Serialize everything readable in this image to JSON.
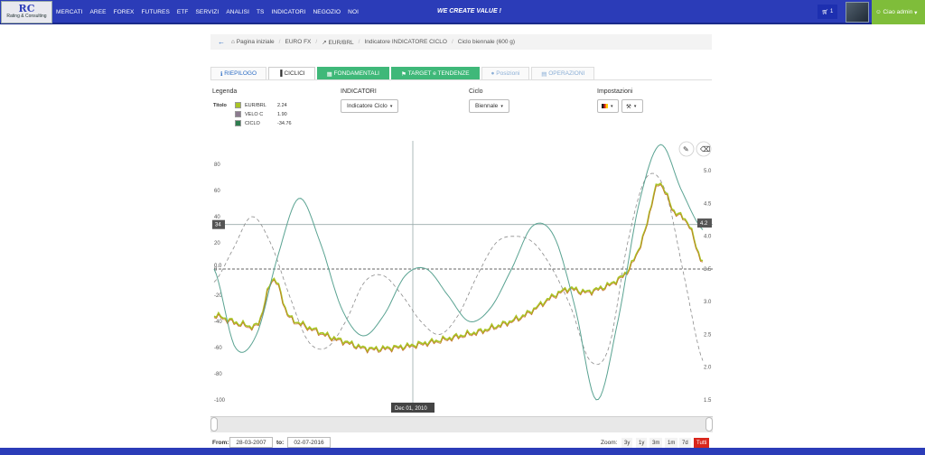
{
  "header": {
    "logo_mark": "RC",
    "logo_text": "Rating & Consulting",
    "nav": [
      "MERCATI",
      "AREE",
      "FOREX",
      "FUTURES",
      "ETF",
      "SERVIZI",
      "ANALISI",
      "TS",
      "INDICATORI",
      "NEGOZIO",
      "NOI"
    ],
    "slogan": "WE CREATE VALUE !",
    "cart_count": "1",
    "user_label": "Ciao admin"
  },
  "breadcrumb": [
    "Pagina iniziale",
    "EURO FX",
    "EUR/BRL",
    "Indicatore INDICATORE CICLO",
    "Ciclo biennale (600 g)"
  ],
  "tabs": [
    {
      "label": "RIEPILOGO",
      "icon": "info-icon"
    },
    {
      "label": "CICLICI",
      "icon": "bar-chart-icon"
    },
    {
      "label": "FONDAMENTALI",
      "icon": "table-icon"
    },
    {
      "label": "TARGET e TENDENZE",
      "icon": "pin-icon"
    },
    {
      "label": "Posizioni",
      "icon": "circle-icon"
    },
    {
      "label": "OPERAZIONI",
      "icon": "calculator-icon"
    }
  ],
  "controls": {
    "legend_label": "Legenda",
    "legend_title": "Titolo",
    "legend": [
      {
        "name": "EUR/BRL",
        "value": "2.24",
        "color": "#a9c426"
      },
      {
        "name": "VELO C",
        "value": "1.90",
        "color": "#8c7b8f"
      },
      {
        "name": "CICLO",
        "value": "-34.76",
        "color": "#2e7d4f"
      }
    ],
    "indicatori_label": "INDICATORI",
    "indicatori_value": "Indicatore Ciclo",
    "ciclo_label": "Ciclo",
    "ciclo_value": "Biennale",
    "impostazioni_label": "Impostazioni"
  },
  "chart_data": {
    "type": "line",
    "left_axis_ticks": [
      "80",
      "60",
      "40",
      "20",
      "0",
      "-20",
      "-40",
      "-60",
      "-80",
      "-100"
    ],
    "right_axis_ticks": [
      "5.0",
      "4.5",
      "4.0",
      "3.5",
      "3.0",
      "2.5",
      "2.0",
      "1.5"
    ],
    "crosshair_x_label": "Dec 01, 2010",
    "crosshair_left_value": "34",
    "crosshair_right_value": "4.2",
    "zero_line_label": "0.0",
    "series": [
      {
        "name": "EUR/BRL",
        "color": "#a9c426",
        "values": [
          2.8,
          2.72,
          2.65,
          2.68,
          3.35,
          2.8,
          2.65,
          2.55,
          2.45,
          2.38,
          2.3,
          2.28,
          2.3,
          2.32,
          2.36,
          2.4,
          2.45,
          2.5,
          2.55,
          2.62,
          2.7,
          2.8,
          2.95,
          3.1,
          3.2,
          3.15,
          3.2,
          3.3,
          3.5,
          4.0,
          4.8,
          4.4,
          4.2,
          3.6
        ]
      },
      {
        "name": "VELO C",
        "color": "#8c7b8f",
        "dashed": true,
        "values": [
          -10,
          15,
          40,
          20,
          -20,
          -55,
          -60,
          -40,
          -10,
          -5,
          -20,
          -40,
          -50,
          -35,
          -5,
          20,
          25,
          20,
          0,
          -30,
          -70,
          -60,
          20,
          70,
          60,
          -5,
          -70
        ]
      },
      {
        "name": "CICLO",
        "color": "#5aa392",
        "values": [
          0,
          -60,
          -50,
          10,
          54,
          20,
          -30,
          -51,
          -35,
          -5,
          0,
          -20,
          -40,
          -30,
          0,
          33,
          25,
          -30,
          -100,
          -40,
          50,
          95,
          60,
          30
        ]
      }
    ]
  },
  "range": {
    "from_label": "From:",
    "from_value": "28-03-2007",
    "to_label": "to:",
    "to_value": "02-07-2016",
    "zoom_label": "Zoom:",
    "zoom_buttons": [
      "3y",
      "1y",
      "3m",
      "1m",
      "7d",
      "Tutti"
    ]
  }
}
